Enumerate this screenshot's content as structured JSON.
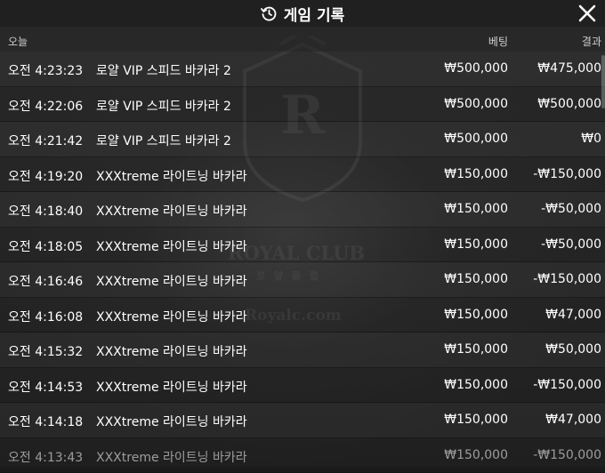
{
  "header": {
    "title": "게임 기록"
  },
  "columns": {
    "date": "오늘",
    "bet": "베팅",
    "result": "결과"
  },
  "watermark": {
    "brand": "ROYAL CLUB",
    "sub": "로 얄 클 럽",
    "site": "Royalc.com",
    "logo_text": "Royal Club"
  },
  "rows": [
    {
      "time": "오전 4:23:23",
      "game": "로얄 VIP 스피드 바카라 2",
      "bet": "₩500,000",
      "result": "₩475,000"
    },
    {
      "time": "오전 4:22:06",
      "game": "로얄 VIP 스피드 바카라 2",
      "bet": "₩500,000",
      "result": "₩500,000"
    },
    {
      "time": "오전 4:21:42",
      "game": "로얄 VIP 스피드 바카라 2",
      "bet": "₩500,000",
      "result": "₩0"
    },
    {
      "time": "오전 4:19:20",
      "game": "XXXtreme 라이트닝 바카라",
      "bet": "₩150,000",
      "result": "-₩150,000"
    },
    {
      "time": "오전 4:18:40",
      "game": "XXXtreme 라이트닝 바카라",
      "bet": "₩150,000",
      "result": "-₩50,000"
    },
    {
      "time": "오전 4:18:05",
      "game": "XXXtreme 라이트닝 바카라",
      "bet": "₩150,000",
      "result": "-₩50,000"
    },
    {
      "time": "오전 4:16:46",
      "game": "XXXtreme 라이트닝 바카라",
      "bet": "₩150,000",
      "result": "-₩150,000"
    },
    {
      "time": "오전 4:16:08",
      "game": "XXXtreme 라이트닝 바카라",
      "bet": "₩150,000",
      "result": "₩47,000"
    },
    {
      "time": "오전 4:15:32",
      "game": "XXXtreme 라이트닝 바카라",
      "bet": "₩150,000",
      "result": "₩50,000"
    },
    {
      "time": "오전 4:14:53",
      "game": "XXXtreme 라이트닝 바카라",
      "bet": "₩150,000",
      "result": "-₩150,000"
    },
    {
      "time": "오전 4:14:18",
      "game": "XXXtreme 라이트닝 바카라",
      "bet": "₩150,000",
      "result": "₩47,000"
    },
    {
      "time": "오전 4:13:43",
      "game": "XXXtreme 라이트닝 바카라",
      "bet": "₩150,000",
      "result": "-₩150,000"
    }
  ],
  "colors": {
    "header_bg": "#1e1e1e",
    "text": "#ffffff",
    "muted": "#d0d0d0"
  }
}
